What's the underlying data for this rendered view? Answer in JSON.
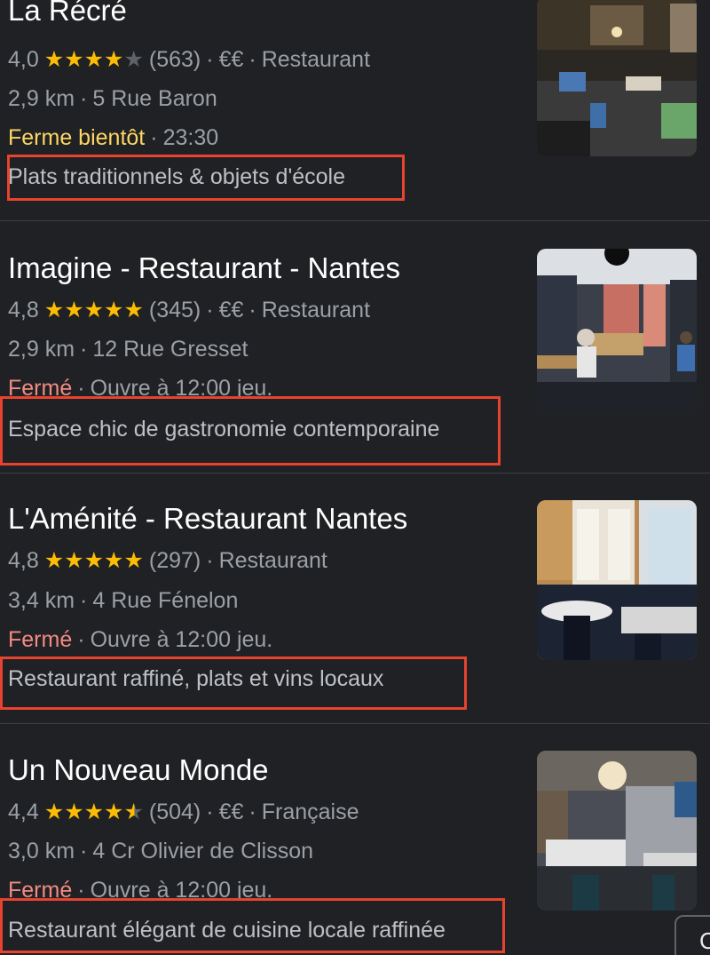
{
  "results": [
    {
      "name": "La Récré",
      "rating": "4,0",
      "stars": [
        "full",
        "full",
        "full",
        "full",
        "empty"
      ],
      "reviews": "(563)",
      "price": "€€",
      "category": "Restaurant",
      "distance": "2,9 km",
      "address": "5 Rue Baron",
      "status": "Ferme bientôt",
      "status_kind": "soon",
      "hours": "23:30",
      "description": "Plats traditionnels & objets d'école",
      "photo": "restaurant-interior-photo"
    },
    {
      "name": "Imagine - Restaurant - Nantes",
      "rating": "4,8",
      "stars": [
        "full",
        "full",
        "full",
        "full",
        "full"
      ],
      "reviews": "(345)",
      "price": "€€",
      "category": "Restaurant",
      "distance": "2,9 km",
      "address": "12 Rue Gresset",
      "status": "Fermé",
      "status_kind": "closed",
      "hours": "Ouvre à 12:00 jeu.",
      "description": "Espace chic de gastronomie contemporaine",
      "photo": "restaurant-dining-room-photo"
    },
    {
      "name": "L'Aménité - Restaurant Nantes",
      "rating": "4,8",
      "stars": [
        "full",
        "full",
        "full",
        "full",
        "full"
      ],
      "reviews": "(297)",
      "price": "",
      "category": "Restaurant",
      "distance": "3,4 km",
      "address": "4 Rue Fénelon",
      "status": "Fermé",
      "status_kind": "closed",
      "hours": "Ouvre à 12:00 jeu.",
      "description": "Restaurant raffiné, plats et vins locaux",
      "photo": "restaurant-window-tables-photo"
    },
    {
      "name": "Un Nouveau Monde",
      "rating": "4,4",
      "stars": [
        "full",
        "full",
        "full",
        "full",
        "half"
      ],
      "reviews": "(504)",
      "price": "€€",
      "category": "Française",
      "distance": "3,0 km",
      "address": "4 Cr Olivier de Clisson",
      "status": "Fermé",
      "status_kind": "closed",
      "hours": "Ouvre à 12:00 jeu.",
      "description": "Restaurant élégant de cuisine locale raffinée",
      "photo": "restaurant-chandelier-photo"
    }
  ],
  "corner_button": {
    "label": "C"
  },
  "colors": {
    "background": "#202124",
    "stars": "#fbbc04",
    "closing_soon": "#fdd663",
    "closed": "#f28b82",
    "highlight_box": "#e8432e"
  }
}
